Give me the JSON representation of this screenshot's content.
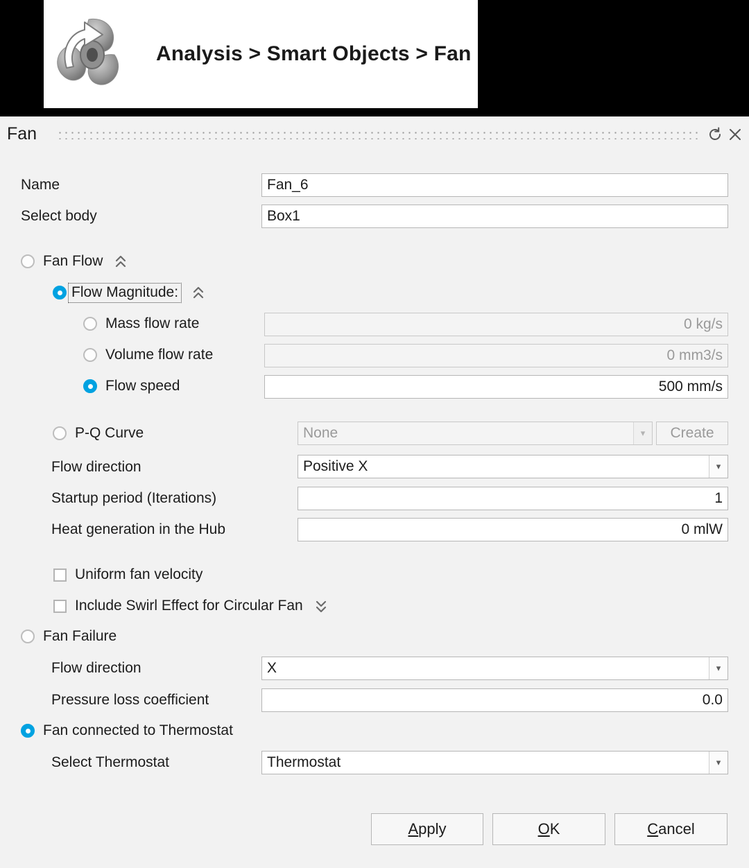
{
  "banner": {
    "icon": "fan-propeller-icon",
    "breadcrumb": "Analysis > Smart Objects > Fan"
  },
  "dialog": {
    "title": "Fan",
    "titlebar_icons": [
      {
        "name": "reset-icon",
        "glyph": "↺"
      },
      {
        "name": "close-icon",
        "glyph": "✕"
      }
    ],
    "fields": {
      "name_label": "Name",
      "name_value": "Fan_6",
      "body_label": "Select body",
      "body_value": "Box1"
    },
    "fan_flow": {
      "label": "Fan Flow",
      "selected": false,
      "collapse_icon": "chevron-double-up-icon",
      "flow_magnitude": {
        "label": "Flow Magnitude:",
        "selected": true,
        "focused": true,
        "collapse_icon": "chevron-double-up-icon",
        "options": [
          {
            "label": "Mass flow rate",
            "selected": false,
            "value": "0 kg/s",
            "enabled": false
          },
          {
            "label": "Volume flow rate",
            "selected": false,
            "value": "0 mm3/s",
            "enabled": false
          },
          {
            "label": "Flow speed",
            "selected": true,
            "value": "500 mm/s",
            "enabled": true
          }
        ]
      },
      "pq_curve": {
        "label": "P-Q Curve",
        "selected": false,
        "enabled": false,
        "dropdown_value": "None",
        "create_label": "Create"
      },
      "flow_direction_label": "Flow direction",
      "flow_direction_value": "Positive X",
      "startup_label": "Startup period (Iterations)",
      "startup_value": "1",
      "heat_label": "Heat generation in the Hub",
      "heat_value": "0 mlW",
      "uniform_velocity": {
        "label": "Uniform fan velocity",
        "checked": false
      },
      "swirl_effect": {
        "label": "Include Swirl Effect for Circular Fan",
        "checked": false,
        "expand_icon": "chevron-double-down-icon"
      }
    },
    "fan_failure": {
      "label": "Fan Failure",
      "selected": false,
      "flow_direction_label": "Flow direction",
      "flow_direction_value": "X",
      "pressure_loss_label": "Pressure loss coefficient",
      "pressure_loss_value": "0.0"
    },
    "thermostat": {
      "label": "Fan connected to Thermostat",
      "selected": true,
      "select_label": "Select Thermostat",
      "select_value": "Thermostat"
    },
    "buttons": {
      "apply": {
        "mnemonic": "A",
        "rest": "pply"
      },
      "ok": {
        "mnemonic": "O",
        "rest": "K"
      },
      "cancel": {
        "mnemonic": "C",
        "rest": "ancel"
      }
    }
  },
  "colors": {
    "accent": "#00a2e1",
    "dialog_bg": "#f2f2f2",
    "text": "#1c1c1c",
    "disabled_text": "#9a9a9a"
  }
}
